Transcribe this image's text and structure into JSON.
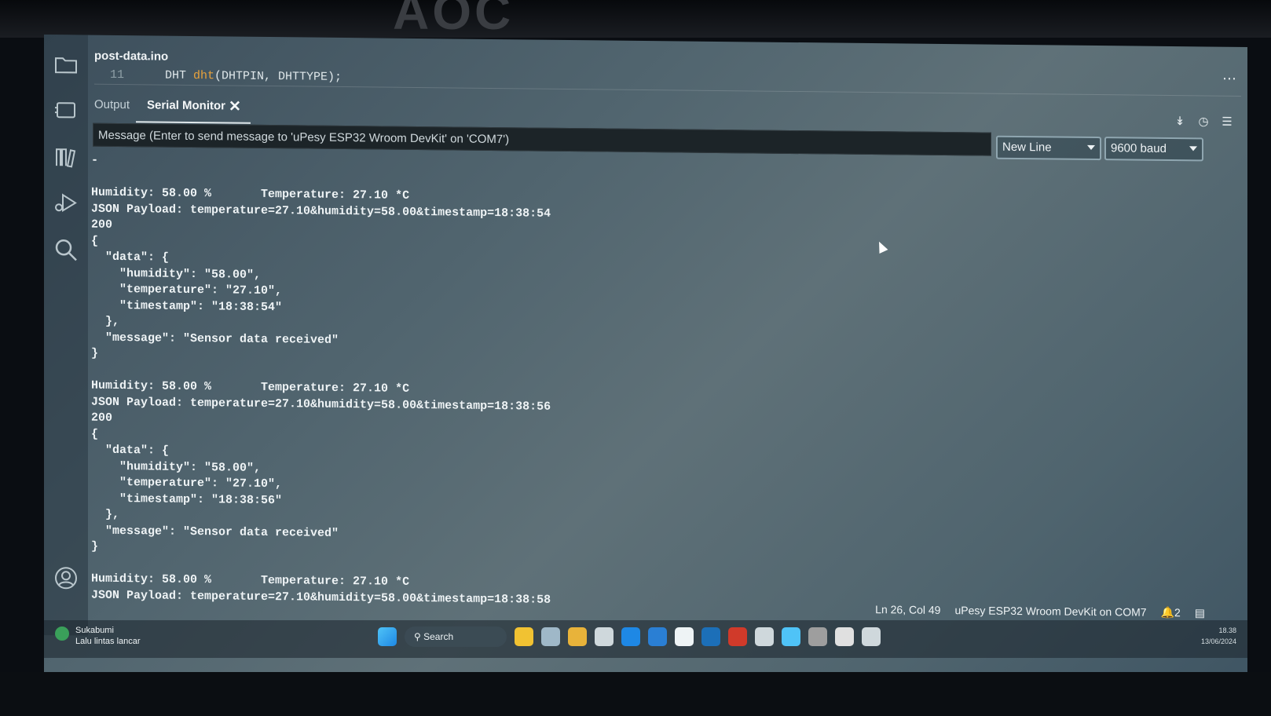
{
  "bezel": {
    "brand": "AOC"
  },
  "editor": {
    "file_tab": "post-data.ino",
    "code_line_number": "11",
    "code_line_text_1": "DHT ",
    "code_line_fn": "dht",
    "code_line_text_2": "(DHTPIN, DHTTYPE);"
  },
  "panel": {
    "tabs": [
      {
        "label": "Output"
      },
      {
        "label": "Serial Monitor"
      }
    ],
    "message_placeholder": "Message (Enter to send message to 'uPesy ESP32 Wroom DevKit' on 'COM7')",
    "line_ending": "New Line",
    "baud": "9600 baud"
  },
  "serial_output": [
    "-",
    "",
    "Humidity: 58.00 %       Temperature: 27.10 *C",
    "JSON Payload: temperature=27.10&humidity=58.00&timestamp=18:38:54",
    "200",
    "{",
    "  \"data\": {",
    "    \"humidity\": \"58.00\",",
    "    \"temperature\": \"27.10\",",
    "    \"timestamp\": \"18:38:54\"",
    "  },",
    "  \"message\": \"Sensor data received\"",
    "}",
    "",
    "Humidity: 58.00 %       Temperature: 27.10 *C",
    "JSON Payload: temperature=27.10&humidity=58.00&timestamp=18:38:56",
    "200",
    "{",
    "  \"data\": {",
    "    \"humidity\": \"58.00\",",
    "    \"temperature\": \"27.10\",",
    "    \"timestamp\": \"18:38:56\"",
    "  },",
    "  \"message\": \"Sensor data received\"",
    "}",
    "",
    "Humidity: 58.00 %       Temperature: 27.10 *C",
    "JSON Payload: temperature=27.10&humidity=58.00&timestamp=18:38:58"
  ],
  "status": {
    "cursor_pos": "Ln 26, Col 49",
    "board": "uPesy ESP32 Wroom DevKit on COM7",
    "notifications": "2"
  },
  "taskbar": {
    "weather_location": "Sukabumi",
    "weather_status": "Lalu lintas lancar",
    "search_label": "Search",
    "time": "18.38",
    "date": "13/06/2024",
    "app_colors": [
      "#f1c232",
      "#9fb8c8",
      "#e8b33a",
      "#cfd8dc",
      "#1e88e5",
      "#2a7fd4",
      "#eef3f5",
      "#1c6fb8",
      "#d03a2a",
      "#cfd8dc",
      "#4fc3f7",
      "#9e9e9e",
      "#e0e0e0",
      "#cfd8dc"
    ]
  }
}
